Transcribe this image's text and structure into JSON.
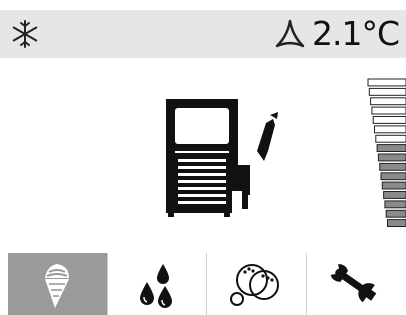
{
  "status": {
    "mode_icon": "snowflake-icon",
    "alert_icon": "triangle-icon",
    "temperature": "2.1°C"
  },
  "main": {
    "machine_icon": "dispenser-machine-icon",
    "level_gauge": {
      "icon": "level-gauge-icon",
      "fill_fraction": 0.55
    }
  },
  "tabs": [
    {
      "icon": "ice-cream-cone-icon",
      "active": true
    },
    {
      "icon": "drops-icon",
      "active": false
    },
    {
      "icon": "bubbles-icon",
      "active": false
    },
    {
      "icon": "wrench-icon",
      "active": false
    }
  ],
  "colors": {
    "status_bg": "#e6e6e6",
    "active_tab": "#9a9a9a",
    "icon": "#111111",
    "gauge_fill": "#8a8a8a"
  }
}
